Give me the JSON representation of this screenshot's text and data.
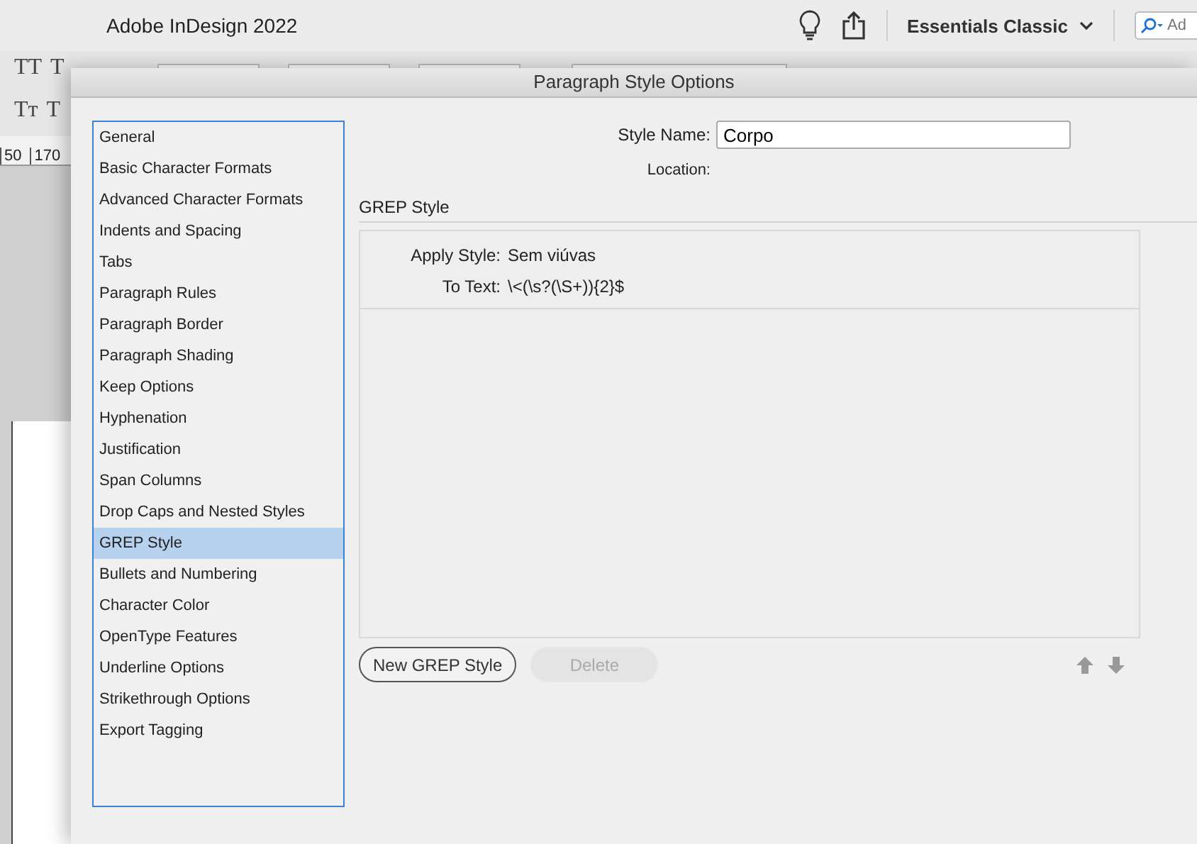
{
  "app": {
    "title": "Adobe InDesign 2022",
    "workspace": "Essentials Classic",
    "search_placeholder": "Ad"
  },
  "toolbar": {
    "row_1": [
      "TT",
      "T"
    ],
    "row_2": [
      "Tт",
      "T"
    ]
  },
  "ruler": [
    "50",
    "170"
  ],
  "dialog": {
    "title": "Paragraph Style Options",
    "categories": [
      {
        "label": "General",
        "selected": false
      },
      {
        "label": "Basic Character Formats",
        "selected": false
      },
      {
        "label": "Advanced Character Formats",
        "selected": false
      },
      {
        "label": "Indents and Spacing",
        "selected": false
      },
      {
        "label": "Tabs",
        "selected": false
      },
      {
        "label": "Paragraph Rules",
        "selected": false
      },
      {
        "label": "Paragraph Border",
        "selected": false
      },
      {
        "label": "Paragraph Shading",
        "selected": false
      },
      {
        "label": "Keep Options",
        "selected": false
      },
      {
        "label": "Hyphenation",
        "selected": false
      },
      {
        "label": "Justification",
        "selected": false
      },
      {
        "label": "Span Columns",
        "selected": false
      },
      {
        "label": "Drop Caps and Nested Styles",
        "selected": false
      },
      {
        "label": "GREP Style",
        "selected": true
      },
      {
        "label": "Bullets and Numbering",
        "selected": false
      },
      {
        "label": "Character Color",
        "selected": false
      },
      {
        "label": "OpenType Features",
        "selected": false
      },
      {
        "label": "Underline Options",
        "selected": false
      },
      {
        "label": "Strikethrough Options",
        "selected": false
      },
      {
        "label": "Export Tagging",
        "selected": false
      }
    ],
    "style_name": {
      "label": "Style Name:",
      "value": "Corpo"
    },
    "location": {
      "label": "Location:"
    },
    "section_title": "GREP Style",
    "rule": [
      {
        "label": "Apply Style:",
        "value": "Sem viúvas"
      },
      {
        "label": "To Text:",
        "value": "\\<(\\s?(\\S+)){2}$"
      }
    ],
    "buttons": [
      {
        "label": "New GREP Style",
        "disabled": false
      },
      {
        "label": "Delete",
        "disabled": true
      }
    ]
  }
}
